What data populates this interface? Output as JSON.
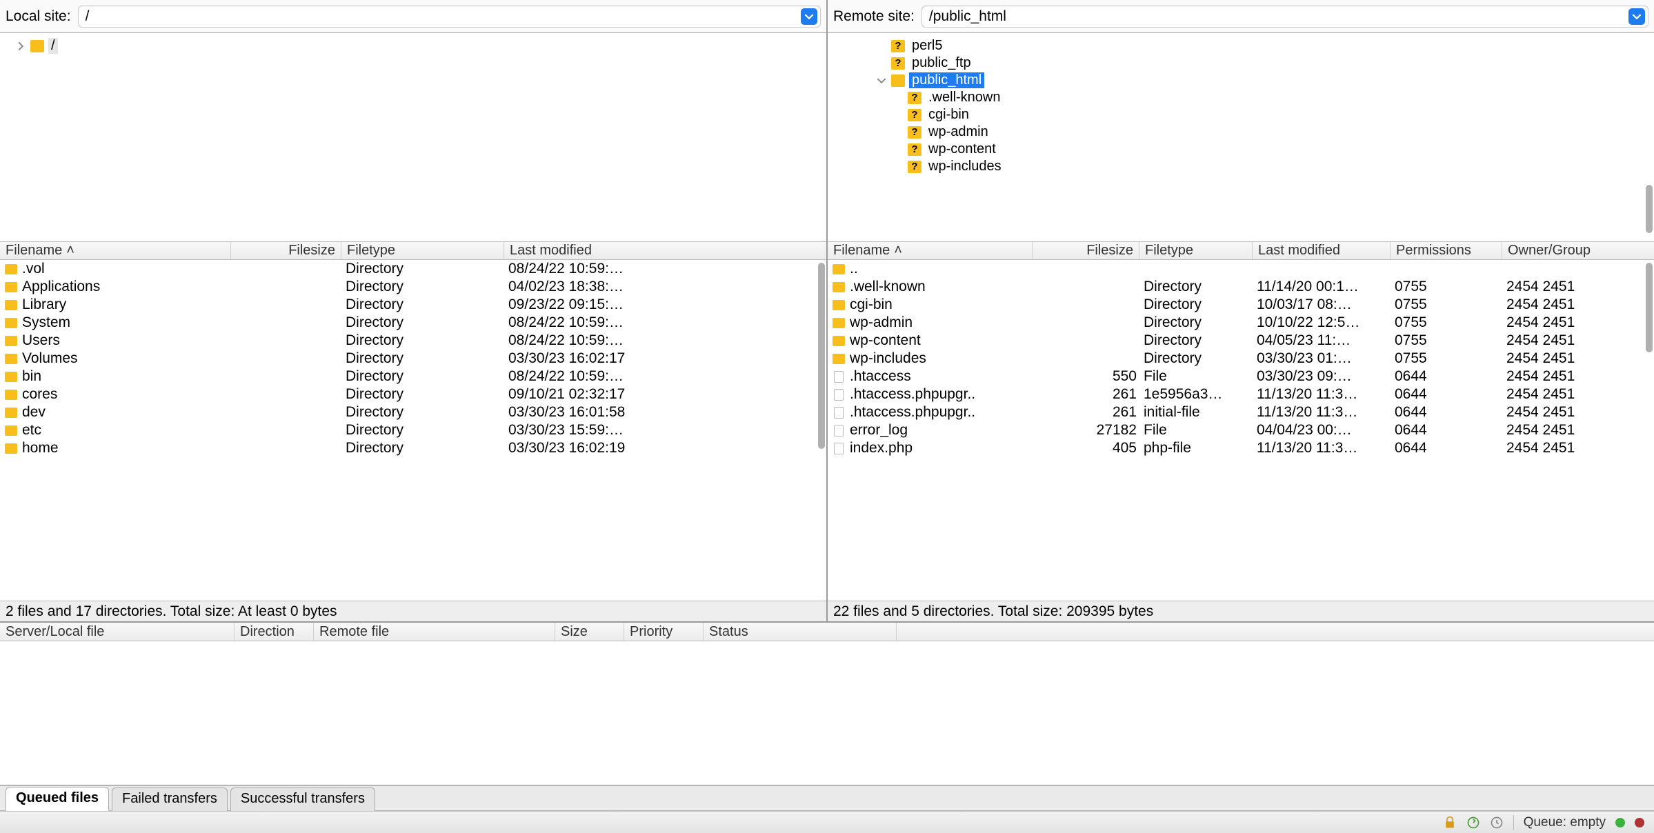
{
  "local": {
    "site_label": "Local site:",
    "path": "/",
    "tree": [
      {
        "indent": 0,
        "disclosure": "right",
        "icon": "folder",
        "label": "/",
        "selected_box": true
      }
    ],
    "col_headers": [
      "Filename",
      "Filesize",
      "Filetype",
      "Last modified"
    ],
    "sort_col": 0,
    "files": [
      {
        "icon": "folder",
        "name": ".vol",
        "size": "",
        "type": "Directory",
        "mod": "08/24/22 10:59:…"
      },
      {
        "icon": "folder",
        "name": "Applications",
        "size": "",
        "type": "Directory",
        "mod": "04/02/23 18:38:…"
      },
      {
        "icon": "folder",
        "name": "Library",
        "size": "",
        "type": "Directory",
        "mod": "09/23/22 09:15:…"
      },
      {
        "icon": "folder",
        "name": "System",
        "size": "",
        "type": "Directory",
        "mod": "08/24/22 10:59:…"
      },
      {
        "icon": "folder",
        "name": "Users",
        "size": "",
        "type": "Directory",
        "mod": "08/24/22 10:59:…"
      },
      {
        "icon": "folder",
        "name": "Volumes",
        "size": "",
        "type": "Directory",
        "mod": "03/30/23 16:02:17"
      },
      {
        "icon": "folder",
        "name": "bin",
        "size": "",
        "type": "Directory",
        "mod": "08/24/22 10:59:…"
      },
      {
        "icon": "folder",
        "name": "cores",
        "size": "",
        "type": "Directory",
        "mod": "09/10/21 02:32:17"
      },
      {
        "icon": "folder",
        "name": "dev",
        "size": "",
        "type": "Directory",
        "mod": "03/30/23 16:01:58"
      },
      {
        "icon": "folder",
        "name": "etc",
        "size": "",
        "type": "Directory",
        "mod": "03/30/23 15:59:…"
      },
      {
        "icon": "folder",
        "name": "home",
        "size": "",
        "type": "Directory",
        "mod": "03/30/23 16:02:19"
      }
    ],
    "status": "2 files and 17 directories. Total size: At least 0 bytes"
  },
  "remote": {
    "site_label": "Remote site:",
    "path": "/public_html",
    "tree": [
      {
        "indent": 2,
        "disclosure": "",
        "icon": "folderq",
        "label": "perl5"
      },
      {
        "indent": 2,
        "disclosure": "",
        "icon": "folderq",
        "label": "public_ftp"
      },
      {
        "indent": 2,
        "disclosure": "down",
        "icon": "folder",
        "label": "public_html",
        "selected": true
      },
      {
        "indent": 3,
        "disclosure": "",
        "icon": "folderq",
        "label": ".well-known"
      },
      {
        "indent": 3,
        "disclosure": "",
        "icon": "folderq",
        "label": "cgi-bin"
      },
      {
        "indent": 3,
        "disclosure": "",
        "icon": "folderq",
        "label": "wp-admin"
      },
      {
        "indent": 3,
        "disclosure": "",
        "icon": "folderq",
        "label": "wp-content"
      },
      {
        "indent": 3,
        "disclosure": "",
        "icon": "folderq",
        "label": "wp-includes"
      }
    ],
    "col_headers": [
      "Filename",
      "Filesize",
      "Filetype",
      "Last modified",
      "Permissions",
      "Owner/Group"
    ],
    "sort_col": 0,
    "files": [
      {
        "icon": "folder",
        "name": "..",
        "size": "",
        "type": "",
        "mod": "",
        "perm": "",
        "owner": ""
      },
      {
        "icon": "folder",
        "name": ".well-known",
        "size": "",
        "type": "Directory",
        "mod": "11/14/20 00:1…",
        "perm": "0755",
        "owner": "2454 2451"
      },
      {
        "icon": "folder",
        "name": "cgi-bin",
        "size": "",
        "type": "Directory",
        "mod": "10/03/17 08:…",
        "perm": "0755",
        "owner": "2454 2451"
      },
      {
        "icon": "folder",
        "name": "wp-admin",
        "size": "",
        "type": "Directory",
        "mod": "10/10/22 12:5…",
        "perm": "0755",
        "owner": "2454 2451"
      },
      {
        "icon": "folder",
        "name": "wp-content",
        "size": "",
        "type": "Directory",
        "mod": "04/05/23 11:…",
        "perm": "0755",
        "owner": "2454 2451"
      },
      {
        "icon": "folder",
        "name": "wp-includes",
        "size": "",
        "type": "Directory",
        "mod": "03/30/23 01:…",
        "perm": "0755",
        "owner": "2454 2451"
      },
      {
        "icon": "file",
        "name": ".htaccess",
        "size": "550",
        "type": "File",
        "mod": "03/30/23 09:…",
        "perm": "0644",
        "owner": "2454 2451"
      },
      {
        "icon": "file",
        "name": ".htaccess.phpupgr..",
        "size": "261",
        "type": "1e5956a3…",
        "mod": "11/13/20 11:3…",
        "perm": "0644",
        "owner": "2454 2451"
      },
      {
        "icon": "file",
        "name": ".htaccess.phpupgr..",
        "size": "261",
        "type": "initial-file",
        "mod": "11/13/20 11:3…",
        "perm": "0644",
        "owner": "2454 2451"
      },
      {
        "icon": "file",
        "name": "error_log",
        "size": "27182",
        "type": "File",
        "mod": "04/04/23 00:…",
        "perm": "0644",
        "owner": "2454 2451"
      },
      {
        "icon": "file",
        "name": "index.php",
        "size": "405",
        "type": "php-file",
        "mod": "11/13/20 11:3…",
        "perm": "0644",
        "owner": "2454 2451"
      }
    ],
    "status": "22 files and 5 directories. Total size: 209395 bytes"
  },
  "queue": {
    "headers": [
      "Server/Local file",
      "Direction",
      "Remote file",
      "Size",
      "Priority",
      "Status"
    ]
  },
  "tabs": [
    "Queued files",
    "Failed transfers",
    "Successful transfers"
  ],
  "active_tab": 0,
  "footer": {
    "queue_label": "Queue: empty"
  }
}
